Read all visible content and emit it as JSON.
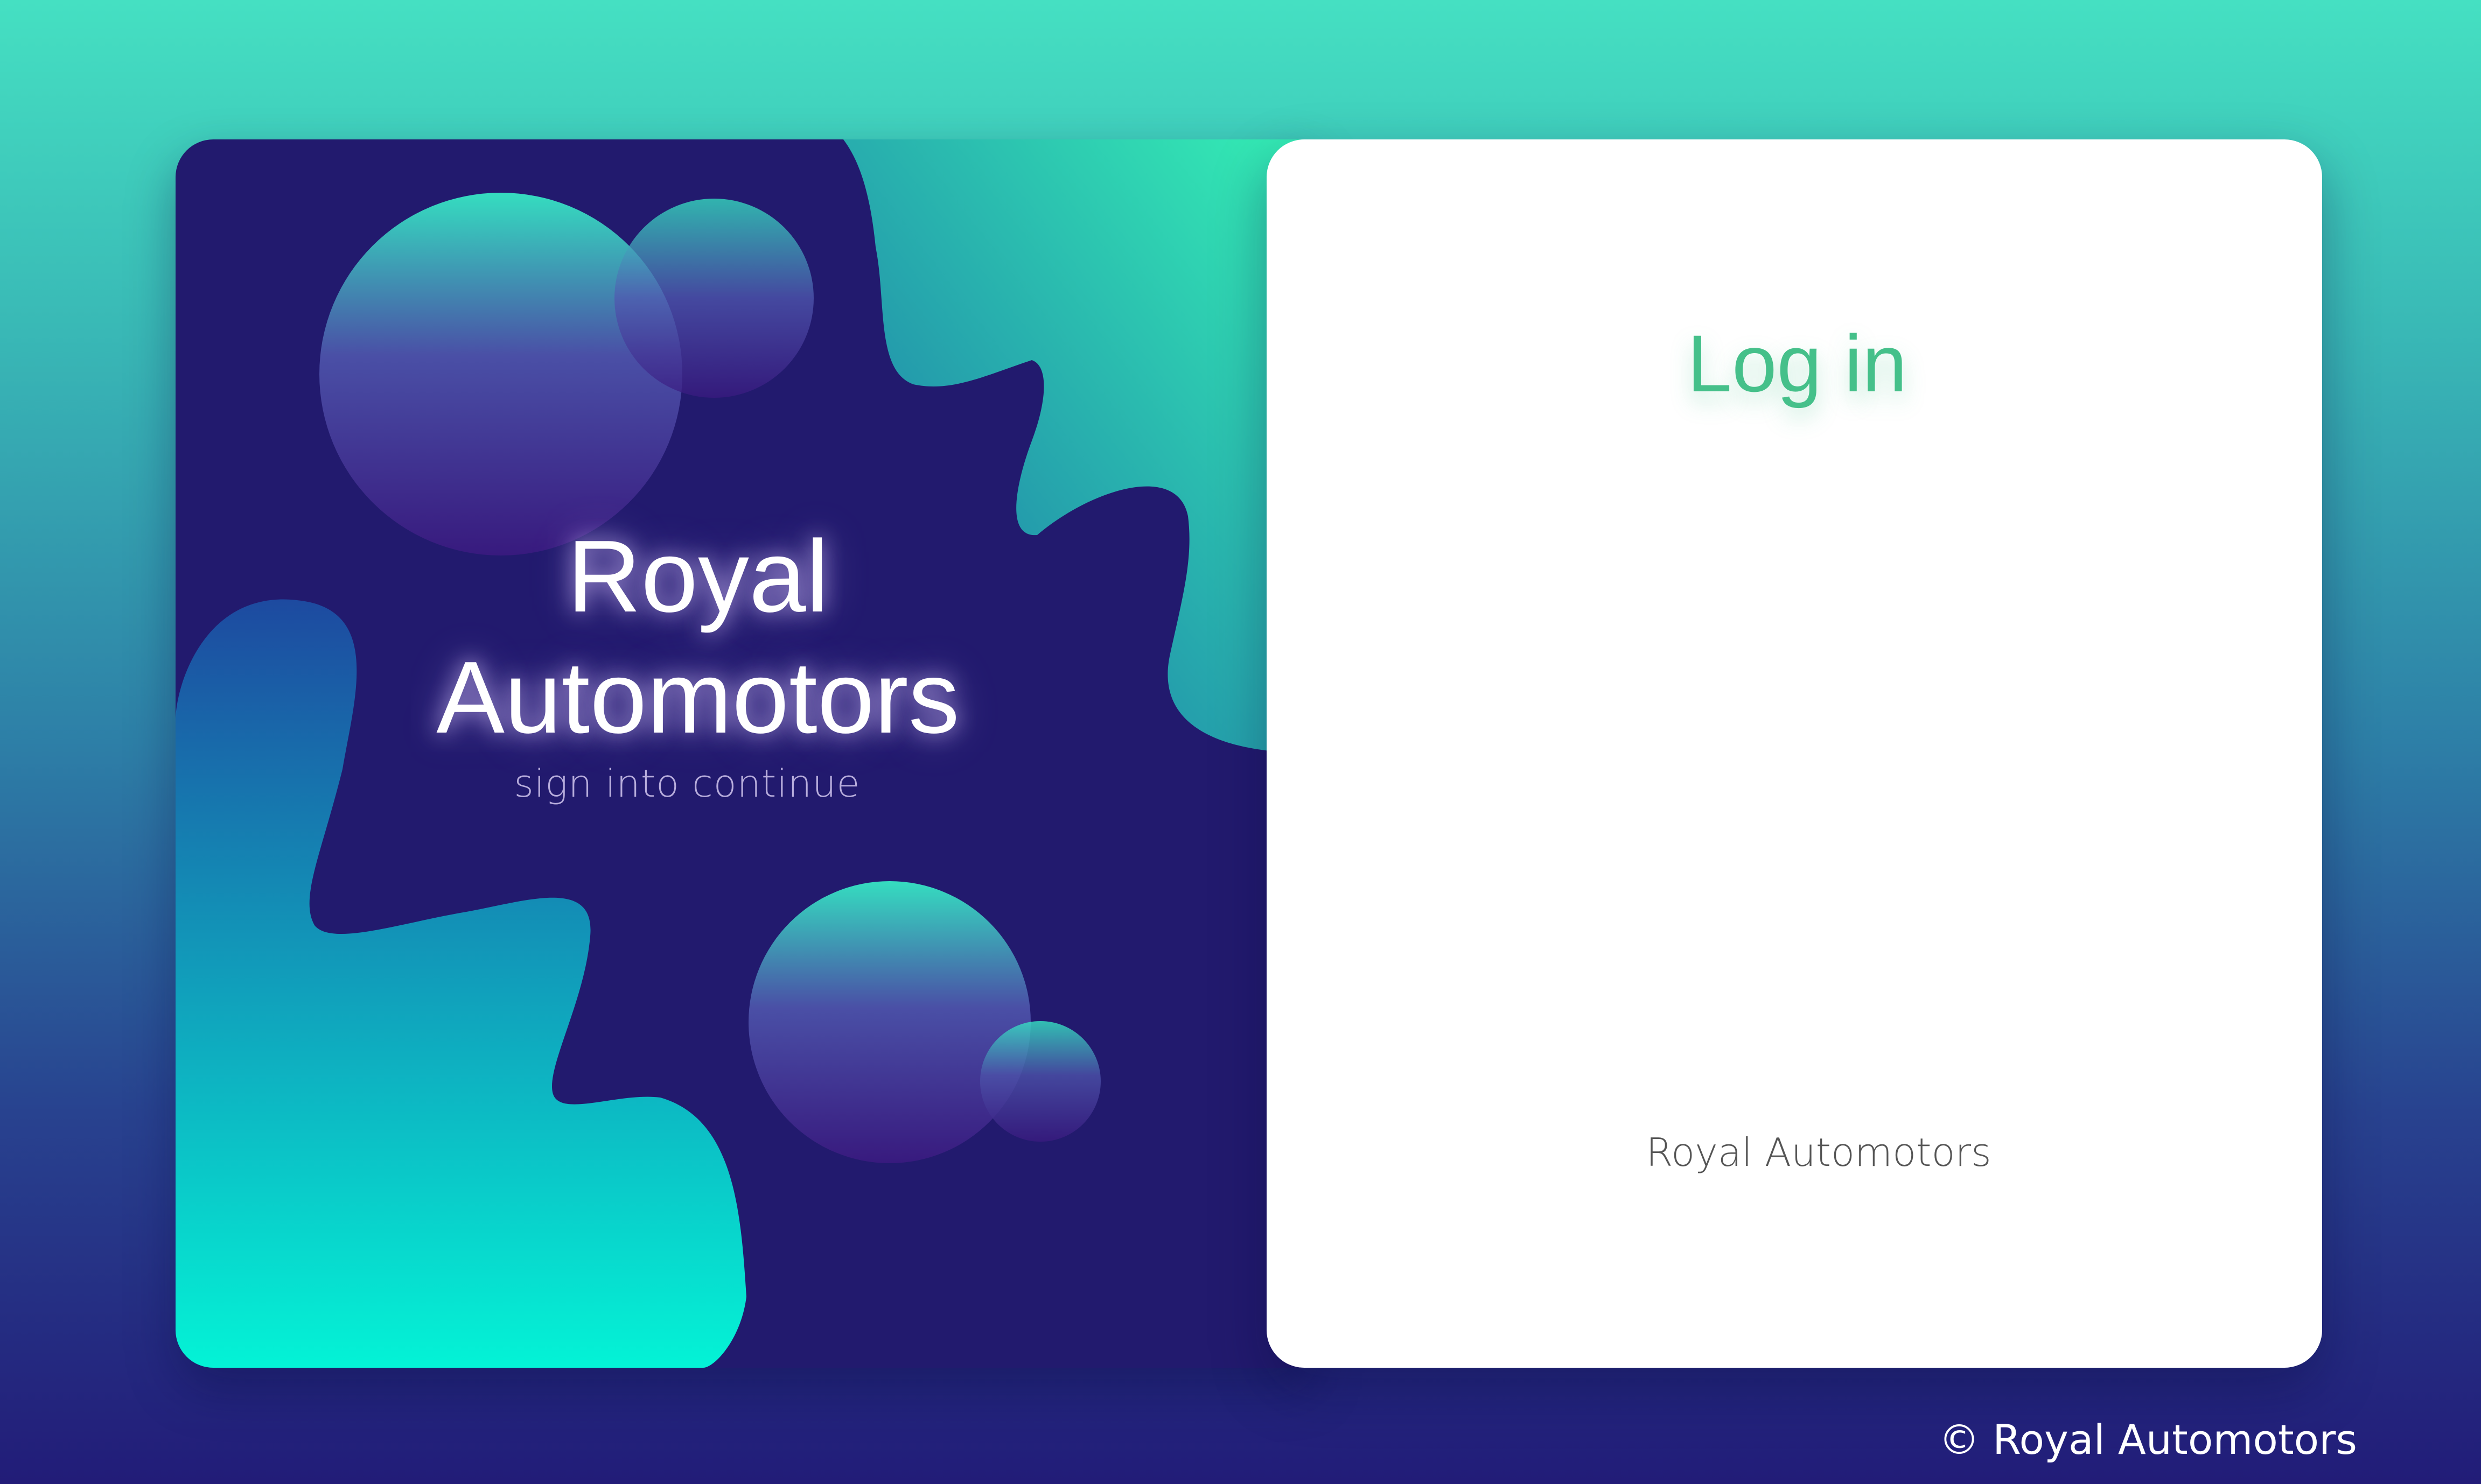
{
  "brand": {
    "line1": "Royal",
    "line2": "Automotors",
    "tagline": "sign into continue"
  },
  "login": {
    "title": "Log in",
    "footer": "Royal  Automotors"
  },
  "page": {
    "copyright": "© Royal  Automotors"
  },
  "colors": {
    "accent_green": "#45c08a",
    "panel_navy": "#221a6e",
    "teal": "#0ff0d4",
    "purple": "#3a1c85"
  }
}
